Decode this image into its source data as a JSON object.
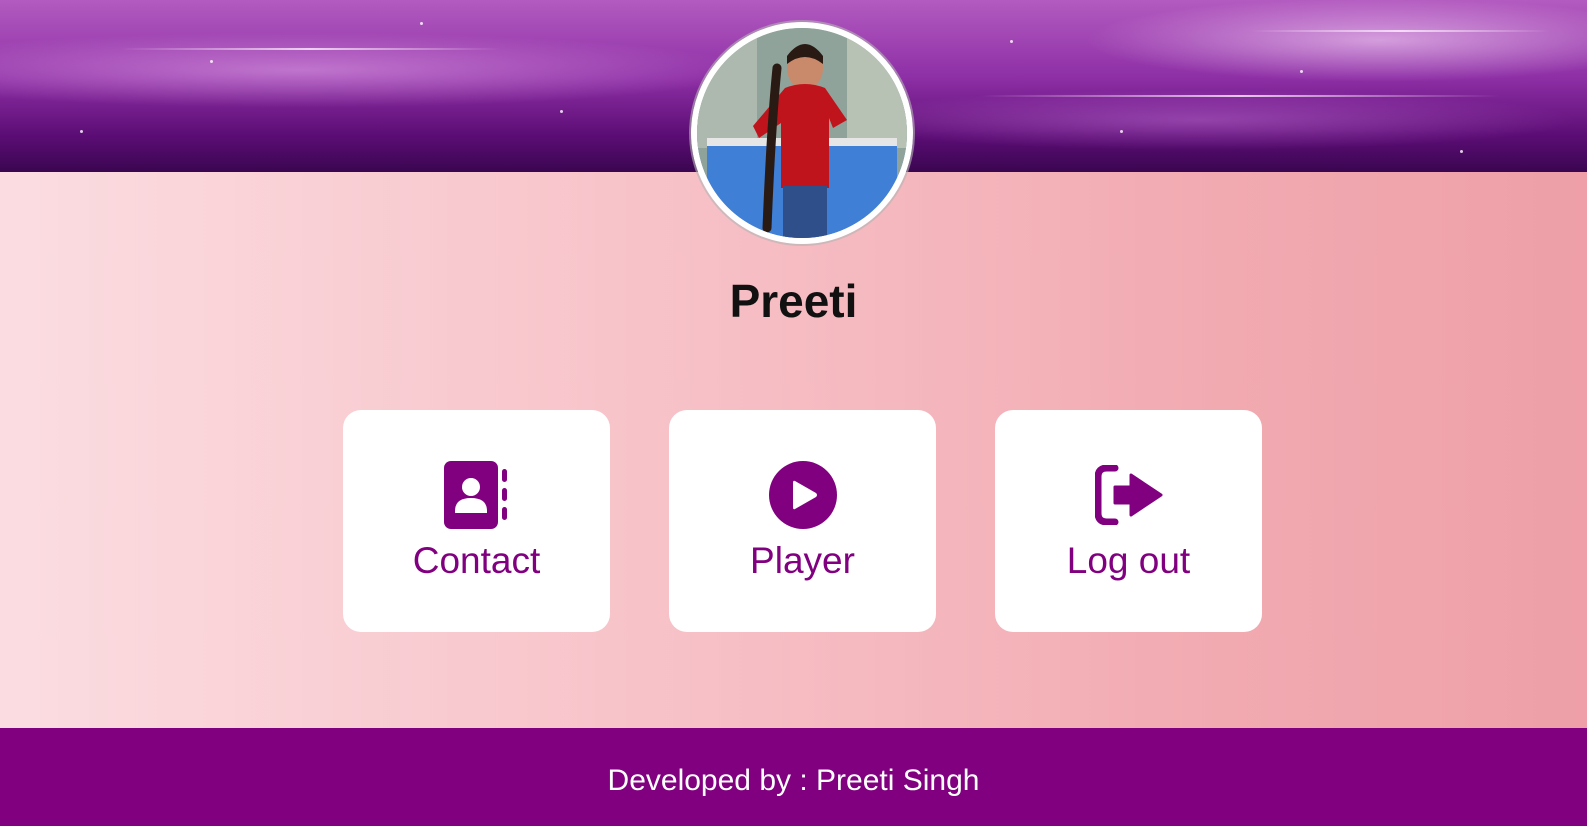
{
  "profile": {
    "name": "Preeti",
    "avatar_icon": "profile-photo"
  },
  "actions": [
    {
      "label": "Contact",
      "icon": "contact-book-icon"
    },
    {
      "label": "Player",
      "icon": "play-circle-icon"
    },
    {
      "label": "Log out",
      "icon": "logout-icon"
    }
  ],
  "footer": {
    "text": "Developed by : Preeti Singh"
  },
  "colors": {
    "accent": "#800080",
    "card_bg": "#ffffff",
    "page_gradient_start": "#fbdde1",
    "page_gradient_end": "#ee9fa7"
  }
}
